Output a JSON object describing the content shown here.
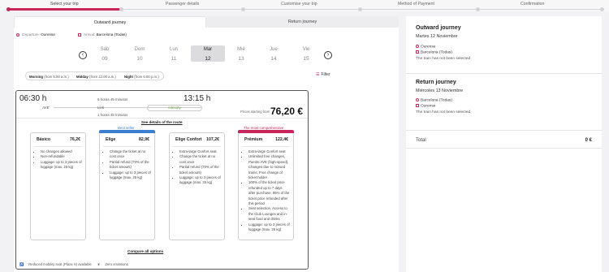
{
  "progress": {
    "steps": [
      "Select your trip",
      "Passenger details",
      "Customise your trip",
      "Method of Payment",
      "Confirmation"
    ],
    "active_index": 0,
    "accent": "#c8255b"
  },
  "tabs": [
    "Outward journey",
    "Return journey"
  ],
  "search": {
    "departure_label": "Departure:",
    "departure_value": "Ourense",
    "arrival_label": "Arrival:",
    "arrival_value": "Barcelona (Todas)"
  },
  "days": [
    {
      "name": "Sáb",
      "num": "09"
    },
    {
      "name": "Dom",
      "num": "10"
    },
    {
      "name": "Lun",
      "num": "11"
    },
    {
      "name": "Mar",
      "num": "12"
    },
    {
      "name": "Mié",
      "num": "13"
    },
    {
      "name": "Jue",
      "num": "14"
    },
    {
      "name": "Vie",
      "num": "15"
    }
  ],
  "filters": {
    "morning": {
      "label": "Morning",
      "range": "(from 5:00 a.m.)"
    },
    "midday": {
      "label": "Midday",
      "range": "(from 12:00 a.m.)"
    },
    "night": {
      "label": "Night",
      "range": "(from 6:00 p.m.)"
    },
    "filter_btn": "Filter"
  },
  "journey": {
    "depart": "06:30 h",
    "arrive": "13:15 h",
    "duration": "6 horas 45 minutos",
    "operator1": "AVE",
    "operator2": "Link",
    "operator2_sub": "1 horas 45 minutos",
    "operator3": "intercity",
    "price_label": "Prices starting from",
    "price": "76,20 €",
    "route_link": "See details of the route"
  },
  "fares": [
    {
      "tag": "",
      "name": "Básico",
      "price": "76,2€",
      "features": [
        "No changes allowed",
        "Non-refundable",
        "Luggage: up to 3 pieces of luggage (max. 25 kg)"
      ]
    },
    {
      "tag": "Best seller",
      "name": "Elige",
      "price": "82,9€",
      "features": [
        "Change the ticket at no cost once",
        "Partial refund (70% of the ticket amount)",
        "Luggage: up to 3 pieces of luggage (max. 25 kg)"
      ]
    },
    {
      "tag": "",
      "name": "Elige Confort",
      "price": "107,2€",
      "features": [
        "Extra-large Confort seat",
        "Change the ticket at no cost once",
        "Partial refund (70% of the ticket amount)",
        "Luggage: up to 3 pieces of luggage (max. 25 kg)"
      ]
    },
    {
      "tag": "The most comprehensive",
      "name": "Prémium",
      "price": "122,4€",
      "features": [
        "Extra-large Confort seat",
        "Unlimited free changes, Puente AVE (high-speed), Changes due to missed trains, Free change of ticket holder",
        "100% of the ticket price refunded up to 7 days after purchase, 95% of the ticket price refunded after this period",
        "Seat selection, Access to the Club Lounges and in-seat food and drinks",
        "Luggage: up to 3 pieces of luggage (max. 25 kg)"
      ]
    }
  ],
  "compare": "Compare all options",
  "card_footer": {
    "reduced": "Reduced mobility seat (Plaza H) available",
    "emissions": "Zero emissions"
  },
  "summary": {
    "outward_title": "Outward journey",
    "outward_date": "Martes 12 Noviembre",
    "outward_from": "Ourense",
    "outward_to": "Barcelona (Todas)",
    "outward_note": "The train has not been selected",
    "return_title": "Return journey",
    "return_date": "Miércoles 13 Noviembre",
    "return_from": "Barcelona (Todas)",
    "return_to": "Ourense",
    "return_note": "The train has not been selected",
    "total_label": "Total",
    "total_value": "0 €"
  }
}
